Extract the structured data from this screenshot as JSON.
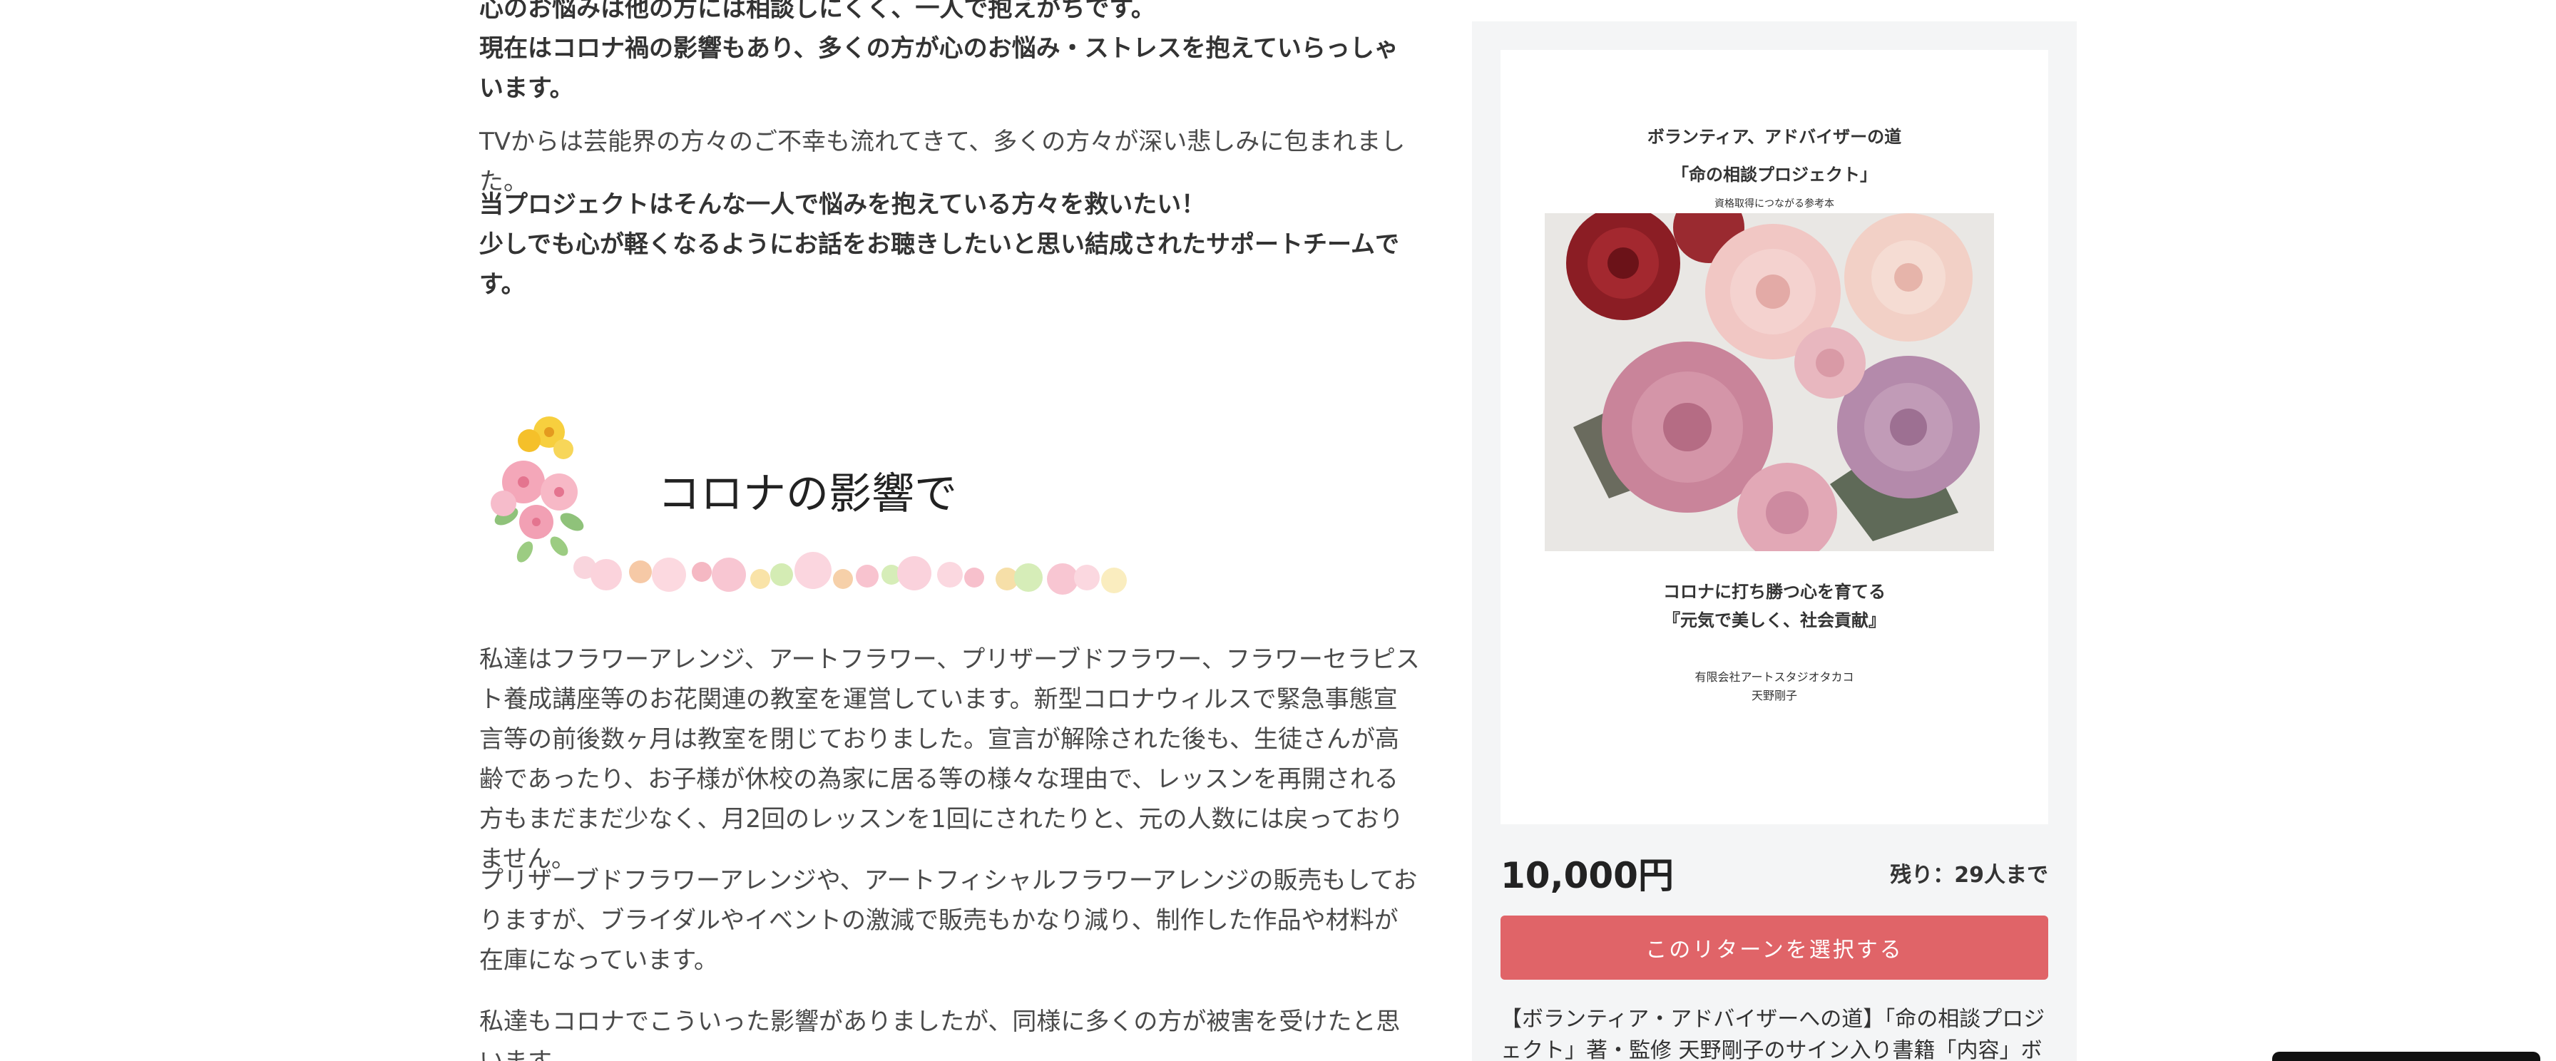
{
  "main": {
    "para_top": "心のお悩みは他の方には相談しにくく、一人で抱えがちです。",
    "para_corona": "現在はコロナ禍の影響もあり、多くの方が心のお悩み・ストレスを抱えていらっしゃいます。",
    "para_tv": "TVからは芸能界の方々のご不幸も流れてきて、多くの方々が深い悲しみに包まれました。",
    "para_project_1": "当プロジェクトはそんな一人で悩みを抱えている方々を救いたい！",
    "para_project_2": "少しでも心が軽くなるようにお話をお聴きしたいと思い結成されたサポートチームです。",
    "heading": "コロナの影響で",
    "para_a": "私達はフラワーアレンジ、アートフラワー、プリザーブドフラワー、フラワーセラピスト養成講座等のお花関連の教室を運営しています。新型コロナウィルスで緊急事態宣言等の前後数ヶ月は教室を閉じておりました。宣言が解除された後も、生徒さんが高齢であったり、お子様が休校の為家に居る等の様々な理由で、レッスンを再開される方もまだまだ少なく、月2回のレッスンを1回にされたりと、元の人数には戻っておりません。",
    "para_b": "プリザーブドフラワーアレンジや、アートフィシャルフラワーアレンジの販売もしておりますが、ブライダルやイベントの激減で販売もかなり減り、制作した作品や材料が在庫になっています。",
    "para_c": "私達もコロナでこういった影響がありましたが、同様に多くの方が被害を受けたと思います。"
  },
  "sidebar": {
    "book": {
      "line1": "ボランティア、アドバイザーの道",
      "line2": "「命の相談プロジェクト」",
      "line3": "資格取得につながる参考本",
      "line4": "コロナに打ち勝つ心を育てる",
      "line5": "『元気で美しく、社会貢献』",
      "line6": "有限会社アートスタジオタカコ",
      "line7": "天野剛子"
    },
    "price": "10,000円",
    "remaining": "残り：29人まで",
    "select_button": "このリターンを選択する",
    "description": "【ボランティア・アドバイザーへの道】「命の相談プロジェクト」著・監修 天野剛子のサイン入り書籍「内容」ボラン"
  },
  "colors": {
    "accent_button": "#e06468",
    "sidebar_bg": "#f4f5f6",
    "text": "#333333"
  },
  "icons": [
    "flower-bouquet-decoration",
    "rose-bouquet-photo"
  ]
}
